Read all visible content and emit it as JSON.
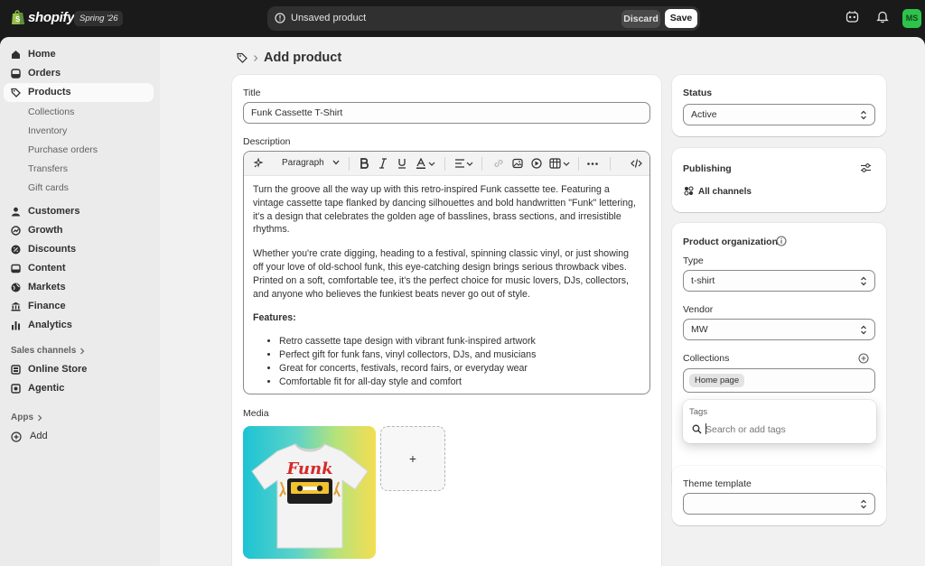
{
  "topbar": {
    "brand": "shopify",
    "edition": "Spring '26",
    "unsaved_text": "Unsaved product",
    "discard_label": "Discard",
    "save_label": "Save",
    "avatar_initials": "MS",
    "avatar_color": "#2ec24a"
  },
  "sidebar": {
    "items": [
      {
        "label": "Home",
        "icon": "home-icon"
      },
      {
        "label": "Orders",
        "icon": "orders-icon"
      },
      {
        "label": "Products",
        "icon": "tag-icon",
        "active": true
      },
      {
        "label": "Customers",
        "icon": "person-icon"
      },
      {
        "label": "Growth",
        "icon": "growth-icon"
      },
      {
        "label": "Discounts",
        "icon": "discount-icon"
      },
      {
        "label": "Content",
        "icon": "content-icon"
      },
      {
        "label": "Markets",
        "icon": "globe-icon"
      },
      {
        "label": "Finance",
        "icon": "bank-icon"
      },
      {
        "label": "Analytics",
        "icon": "chart-icon"
      }
    ],
    "product_subitems": [
      "Collections",
      "Inventory",
      "Purchase orders",
      "Transfers",
      "Gift cards"
    ],
    "sales_channels_label": "Sales channels",
    "channels": [
      {
        "label": "Online Store",
        "icon": "store-icon"
      },
      {
        "label": "Agentic",
        "icon": "agentic-icon"
      }
    ],
    "apps_label": "Apps",
    "add_label": "Add"
  },
  "page": {
    "title": "Add product"
  },
  "product": {
    "title_label": "Title",
    "title_value": "Funk Cassette T-Shirt",
    "description_label": "Description",
    "paragraph_style": "Paragraph",
    "paragraphs": [
      "Turn the groove all the way up with this retro-inspired Funk cassette tee. Featuring a vintage cassette tape flanked by dancing silhouettes and bold handwritten \"Funk\" lettering, it's a design that celebrates the golden age of basslines, brass sections, and irresistible rhythms.",
      "Whether you're crate digging, heading to a festival, spinning classic vinyl, or just showing off your love of old-school funk, this eye-catching design brings serious throwback vibes. Printed on a soft, comfortable tee, it's the perfect choice for music lovers, DJs, collectors, and anyone who believes the funkiest beats never go out of style."
    ],
    "features_heading": "Features:",
    "features": [
      "Retro cassette tape design with vibrant funk-inspired artwork",
      "Perfect gift for funk fans, vinyl collectors, DJs, and musicians",
      "Great for concerts, festivals, record fairs, or everyday wear",
      "Comfortable fit for all-day style and comfort"
    ],
    "media_label": "Media",
    "media_add": "+",
    "shirt_text": "Funk"
  },
  "status": {
    "label": "Status",
    "value": "Active"
  },
  "publishing": {
    "label": "Publishing",
    "channels": "All channels"
  },
  "organization": {
    "label": "Product organization",
    "type_label": "Type",
    "type_value": "t-shirt",
    "vendor_label": "Vendor",
    "vendor_value": "MW",
    "collections_label": "Collections",
    "collection_chip": "Home page",
    "tags_label": "Tags",
    "tags_placeholder": "Search or add tags"
  },
  "theme": {
    "label": "Theme template",
    "value": ""
  }
}
